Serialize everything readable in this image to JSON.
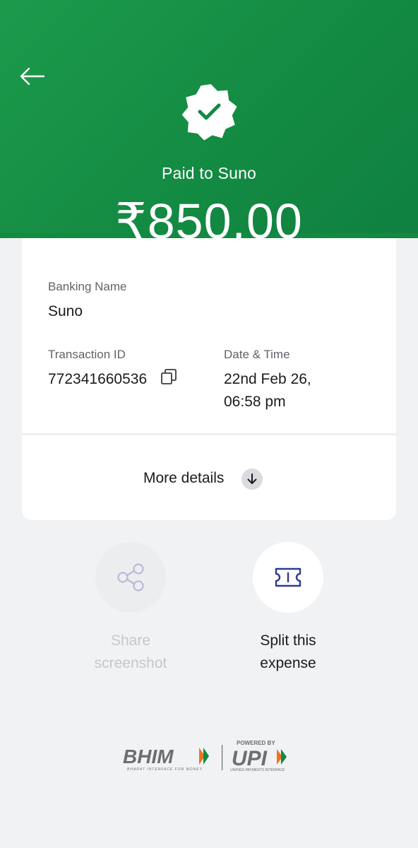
{
  "header": {
    "back_icon": "arrow-left-icon",
    "badge_icon": "verified-check-badge-icon",
    "paid_to": "Paid to Suno",
    "amount": "₹850.00",
    "colors": {
      "primary": "#138a42",
      "on_primary": "#ffffff"
    }
  },
  "details": {
    "banking_name_label": "Banking Name",
    "banking_name_value": "Suno",
    "transaction_id_label": "Transaction ID",
    "transaction_id_value": "772341660536",
    "copy_icon": "copy-icon",
    "date_time_label": "Date & Time",
    "date_line1": "22nd Feb 26,",
    "date_line2": "06:58 pm",
    "more_details_label": "More details",
    "more_details_icon": "arrow-down-icon"
  },
  "actions": {
    "share": {
      "line1": "Share",
      "line2": "screenshot",
      "icon": "share-icon",
      "disabled": true
    },
    "split": {
      "line1": "Split this",
      "line2": "expense",
      "icon": "ticket-split-icon",
      "disabled": false
    }
  },
  "footer": {
    "bhim_text": "BHIM",
    "bhim_tagline": "BHARAT INTERFACE FOR MONEY",
    "powered_by": "POWERED BY",
    "upi_text": "UPI",
    "upi_tagline": "UNIFIED PAYMENTS INTERFACE"
  }
}
